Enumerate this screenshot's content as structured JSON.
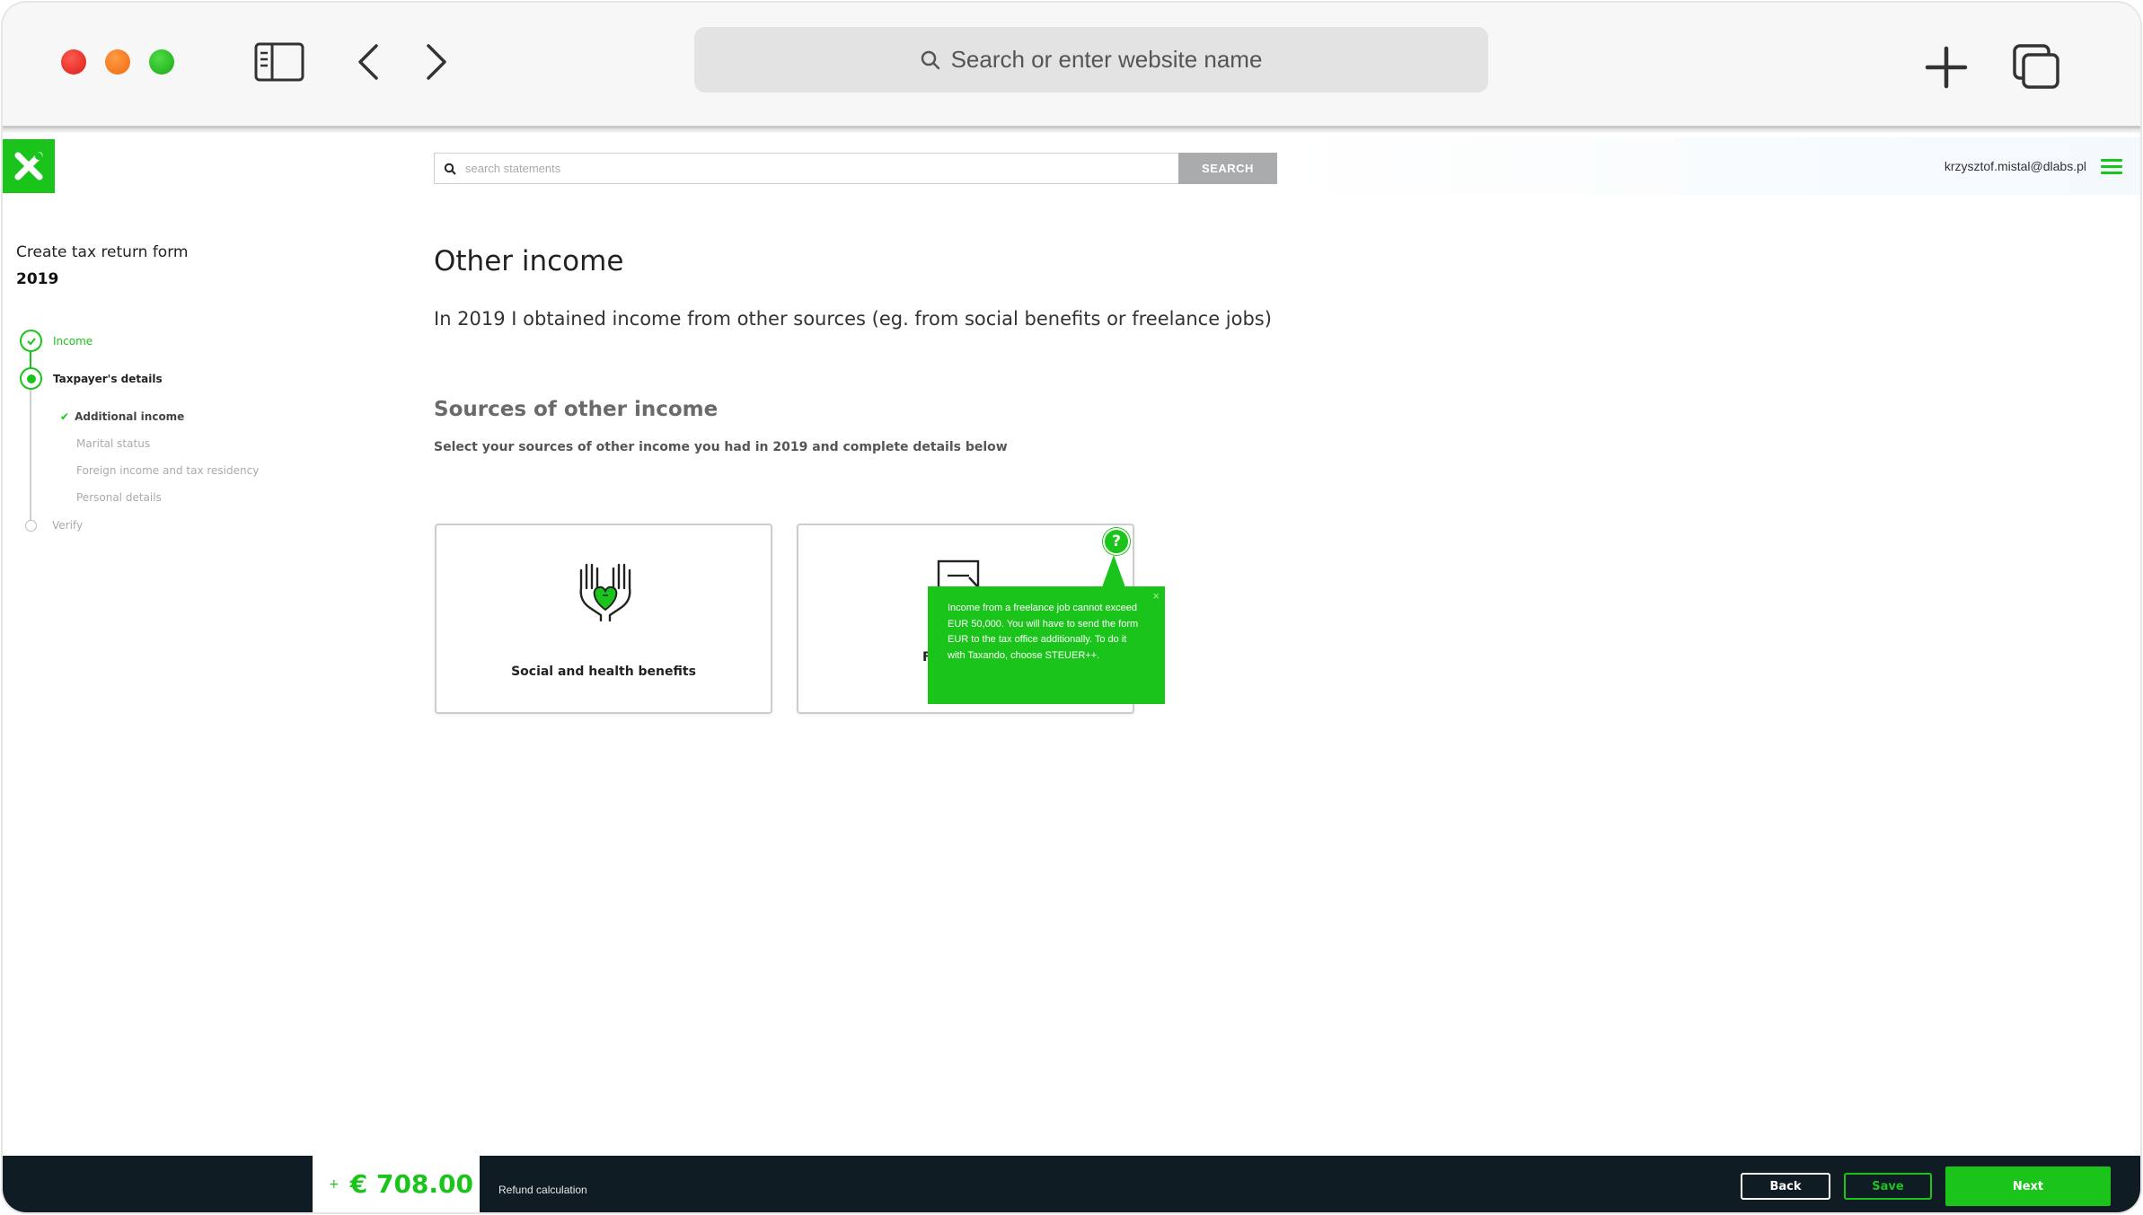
{
  "browser": {
    "address_placeholder": "Search or enter website name"
  },
  "topbar": {
    "search_placeholder": "search statements",
    "search_button": "SEARCH",
    "user_email": "krzysztof.mistal@dlabs.pl"
  },
  "sidebar": {
    "title": "Create tax return form",
    "year": "2019",
    "steps": [
      {
        "label": "Income",
        "state": "done"
      },
      {
        "label": "Taxpayer's details",
        "state": "current"
      },
      {
        "label": "Verify",
        "state": "pending"
      }
    ],
    "substeps": [
      {
        "label": "Additional income",
        "state": "done"
      },
      {
        "label": "Marital status",
        "state": "pending"
      },
      {
        "label": "Foreign income and tax residency",
        "state": "pending"
      },
      {
        "label": "Personal details",
        "state": "pending"
      }
    ]
  },
  "main": {
    "title": "Other income",
    "lead": "In 2019 I obtained income from other sources (eg. from social benefits or freelance jobs)",
    "section_title": "Sources of other income",
    "section_desc": "Select your sources of other income you had in 2019 and complete details below",
    "cards": [
      {
        "label": "Social and health benefits",
        "icon": "hands-heart-icon"
      },
      {
        "label": "F",
        "icon": "document-pen-icon"
      }
    ],
    "help_symbol": "?",
    "tooltip": {
      "text": "Income from a freelance job cannot exceed EUR 50,000. You will have to send the form EUR to the tax office additionally. To do it with Taxando, choose STEUER++.",
      "close": "×"
    }
  },
  "footer": {
    "refund_sign": "+",
    "refund_amount": "€ 708.00",
    "refund_label": "Refund calculation",
    "back": "Back",
    "save": "Save",
    "next": "Next"
  },
  "colors": {
    "accent": "#1bc41b",
    "footer_bg": "#0f1c24"
  }
}
